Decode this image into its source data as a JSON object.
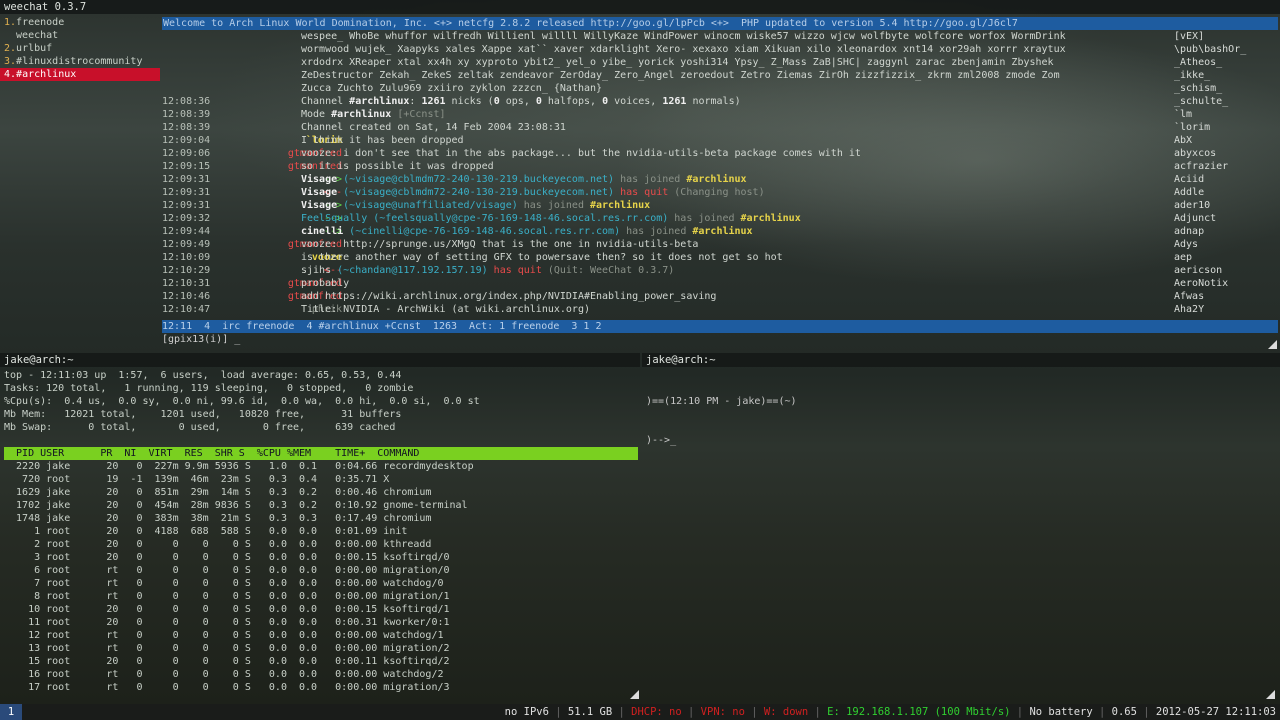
{
  "weechat": {
    "title": "weechat 0.3.7",
    "buffers": [
      {
        "num": "1.",
        "name": "freenode",
        "cur": false
      },
      {
        "num": "",
        "name": "weechat",
        "cur": false
      },
      {
        "num": "2.",
        "name": "urlbuf",
        "cur": false
      },
      {
        "num": "3.",
        "name": "#linuxdistrocommunity",
        "cur": false
      },
      {
        "num": "4.",
        "name": "#archlinux",
        "cur": true
      }
    ],
    "topic": "Welcome to Arch Linux World Domination, Inc. <+> netcfg 2.8.2 released http://goo.gl/lpPcb <+>  PHP updated to version 5.4 http://goo.gl/J6cl7",
    "names_lines": [
      "wespee_ WhoBe whuffor wilfredh Willienl willll WillyKaze WindPower winocm wiske57 wizzo wjcw wolfbyte wolfcore worfox WormDrink",
      "wormwood wujek_ Xaapyks xales Xappe xat`` xaver xdarklight Xero- xexaxo xiam Xikuan xilo xleonardox xnt14 xor29ah xorrr xraytux",
      "xrdodrx XReaper xtal xx4h xy xyproto ybit2_ yel_o yibe_ yorick yoshi314 Ypsy_ Z_Mass ZaB|SHC| zaggynl zarac zbenjamin Zbyshek",
      "ZeDestructor Zekah_ ZekeS zeltak zendeavor ZerOday_ Zero_Angel zeroedout Zetro Ziemas ZirOh zizzfizzix_ zkrm zml2008 zmode Zom",
      "Zucca Zuchto Zulu969 zxiiro zyklon zzzcn_ {Nathan}"
    ],
    "lines": [
      {
        "ts": "12:08:36",
        "nick": "--",
        "nc": "g",
        "parts": [
          [
            "m",
            "Channel "
          ],
          [
            "w",
            "#archlinux"
          ],
          [
            "m",
            ": "
          ],
          [
            "w",
            "1261"
          ],
          [
            "m",
            " nicks ("
          ],
          [
            "w",
            "0"
          ],
          [
            "m",
            " ops, "
          ],
          [
            "w",
            "0"
          ],
          [
            "m",
            " halfops, "
          ],
          [
            "w",
            "0"
          ],
          [
            "m",
            " voices, "
          ],
          [
            "w",
            "1261"
          ],
          [
            "m",
            " normals)"
          ]
        ]
      },
      {
        "ts": "12:08:39",
        "nick": "--",
        "nc": "g",
        "parts": [
          [
            "m",
            "Mode "
          ],
          [
            "w",
            "#archlinux"
          ],
          [
            "g",
            " [+Ccnst]"
          ]
        ]
      },
      {
        "ts": "12:08:39",
        "nick": "--",
        "nc": "g",
        "parts": [
          [
            "m",
            "Channel created on Sat, 14 Feb 2004 23:08:31"
          ]
        ]
      },
      {
        "ts": "12:09:04",
        "nick": "`lorim",
        "nc": "y",
        "parts": [
          [
            "m",
            "I think it has been dropped"
          ]
        ]
      },
      {
        "ts": "12:09:06",
        "nick": "gtmanfred",
        "nc": "p",
        "parts": [
          [
            "m",
            "vooze: i don't see that in the abs package... but the nvidia-utils-beta package comes with it"
          ]
        ]
      },
      {
        "ts": "12:09:15",
        "nick": "gtmanfred",
        "nc": "p",
        "parts": [
          [
            "m",
            "so it is possible it was dropped"
          ]
        ]
      },
      {
        "ts": "12:09:31",
        "nick": "-->",
        "nc": "j",
        "parts": [
          [
            "w",
            "Visage"
          ],
          [
            "c",
            " (~visage@cblmdm72-240-130-219.buckeyecom.net)"
          ],
          [
            "g",
            " has joined "
          ],
          [
            "y",
            "#archlinux"
          ]
        ]
      },
      {
        "ts": "12:09:31",
        "nick": "<--",
        "nc": "p",
        "parts": [
          [
            "w",
            "Visage"
          ],
          [
            "c",
            " (~visage@cblmdm72-240-130-219.buckeyecom.net)"
          ],
          [
            "p",
            " has quit"
          ],
          [
            "g",
            " (Changing host)"
          ]
        ]
      },
      {
        "ts": "12:09:31",
        "nick": "-->",
        "nc": "j",
        "parts": [
          [
            "w",
            "Visage"
          ],
          [
            "c",
            " (~visage@unaffiliated/visage)"
          ],
          [
            "g",
            " has joined "
          ],
          [
            "y",
            "#archlinux"
          ]
        ]
      },
      {
        "ts": "12:09:32",
        "nick": "-->",
        "nc": "j",
        "parts": [
          [
            "c",
            "FeelSqually (~feelsqually@cpe-76-169-148-46.socal.res.rr.com)"
          ],
          [
            "g",
            " has joined "
          ],
          [
            "y",
            "#archlinux"
          ]
        ]
      },
      {
        "ts": "12:09:44",
        "nick": "-->",
        "nc": "j",
        "parts": [
          [
            "w",
            "cinelli"
          ],
          [
            "c",
            " (~cinelli@cpe-76-169-148-46.socal.res.rr.com)"
          ],
          [
            "g",
            " has joined "
          ],
          [
            "y",
            "#archlinux"
          ]
        ]
      },
      {
        "ts": "12:09:49",
        "nick": "gtmanfred",
        "nc": "p",
        "parts": [
          [
            "m",
            "vooze: http://sprunge.us/XMgQ that is the one in nvidia-utils-beta"
          ]
        ]
      },
      {
        "ts": "12:10:09",
        "nick": "vooze",
        "nc": "y",
        "parts": [
          [
            "m",
            "is there another way of setting GFX to powersave then? so it does not get so hot"
          ]
        ]
      },
      {
        "ts": "12:10:29",
        "nick": "<--",
        "nc": "p",
        "parts": [
          [
            "m",
            "sjihs"
          ],
          [
            "c",
            " (~chandan@117.192.157.19)"
          ],
          [
            "p",
            " has quit"
          ],
          [
            "g",
            " (Quit: WeeChat 0.3.7)"
          ]
        ]
      },
      {
        "ts": "12:10:31",
        "nick": "gtmanfred",
        "nc": "p",
        "parts": [
          [
            "m",
            "probably"
          ]
        ]
      },
      {
        "ts": "12:10:46",
        "nick": "gtmanfred",
        "nc": "p",
        "parts": [
          [
            "m",
            "add https://wiki.archlinux.org/index.php/NVIDIA#Enabling_power_saving"
          ]
        ]
      },
      {
        "ts": "12:10:47",
        "nick": "phrik",
        "nc": "g",
        "parts": [
          [
            "m",
            "Title: NVIDIA - ArchWiki (at wiki.archlinux.org)"
          ]
        ]
      }
    ],
    "nicklist": [
      "[vEX]",
      "\\pub\\bashOr_",
      "_Atheos_",
      "_ikke_",
      "_schism_",
      "_schulte_",
      "`lm",
      "`lorim",
      "AbX",
      "abyxcos",
      "acfrazier",
      "Aciid",
      "Addle",
      "ader10",
      "Adjunct",
      "adnap",
      "Adys",
      "aep",
      "aericson",
      "AeroNotix",
      "Afwas",
      "Aha2Y"
    ],
    "status": [
      [
        "",
        "[12:11] "
      ],
      [
        "",
        "[4] "
      ],
      [
        "",
        "[irc/freenode] "
      ],
      [
        "w",
        "4:#archlinux"
      ],
      [
        "",
        "(+Ccnst)"
      ],
      [
        "",
        "{1263} "
      ],
      [
        "",
        "[Act: 1:freenode] "
      ],
      [
        "w",
        "3 1 2"
      ]
    ],
    "status_text": "12:11  4  irc freenode  4 #archlinux +Ccnst  1263  Act: 1 freenode  3 1 2",
    "input": "[gpix13(i)] _"
  },
  "term_left": {
    "title": "jake@arch:~",
    "summary": [
      "top - 12:11:03 up  1:57,  6 users,  load average: 0.65, 0.53, 0.44",
      "Tasks: 120 total,   1 running, 119 sleeping,   0 stopped,   0 zombie",
      "%Cpu(s):  0.4 us,  0.0 sy,  0.0 ni, 99.6 id,  0.0 wa,  0.0 hi,  0.0 si,  0.0 st",
      "Mb Mem:   12021 total,    1201 used,   10820 free,      31 buffers",
      "Mb Swap:      0 total,       0 used,       0 free,     639 cached"
    ],
    "header": "  PID USER      PR  NI  VIRT  RES  SHR S  %CPU %MEM    TIME+  COMMAND",
    "procs": [
      "  2220 jake      20   0  227m 9.9m 5936 S   1.0  0.1   0:04.66 recordmydesktop",
      "   720 root      19  -1  139m  46m  23m S   0.3  0.4   0:35.71 X",
      "  1629 jake      20   0  851m  29m  14m S   0.3  0.2   0:00.46 chromium",
      "  1702 jake      20   0  454m  28m 9836 S   0.3  0.2   0:10.92 gnome-terminal",
      "  1748 jake      20   0  383m  38m  21m S   0.3  0.3   0:17.49 chromium",
      "     1 root      20   0  4188  688  588 S   0.0  0.0   0:01.09 init",
      "     2 root      20   0     0    0    0 S   0.0  0.0   0:00.00 kthreadd",
      "     3 root      20   0     0    0    0 S   0.0  0.0   0:00.15 ksoftirqd/0",
      "     6 root      rt   0     0    0    0 S   0.0  0.0   0:00.00 migration/0",
      "     7 root      rt   0     0    0    0 S   0.0  0.0   0:00.00 watchdog/0",
      "     8 root      rt   0     0    0    0 S   0.0  0.0   0:00.00 migration/1",
      "    10 root      20   0     0    0    0 S   0.0  0.0   0:00.15 ksoftirqd/1",
      "    11 root      20   0     0    0    0 S   0.0  0.0   0:00.31 kworker/0:1",
      "    12 root      rt   0     0    0    0 S   0.0  0.0   0:00.00 watchdog/1",
      "    13 root      rt   0     0    0    0 S   0.0  0.0   0:00.00 migration/2",
      "    15 root      20   0     0    0    0 S   0.0  0.0   0:00.11 ksoftirqd/2",
      "    16 root      rt   0     0    0    0 S   0.0  0.0   0:00.00 watchdog/2",
      "    17 root      rt   0     0    0    0 S   0.0  0.0   0:00.00 migration/3"
    ]
  },
  "term_right": {
    "title": "jake@arch:~",
    "prompt1": ")==(12:10 PM - jake)==(~)",
    "prompt2": ")-->_"
  },
  "bar": {
    "workspace": "1",
    "ipv6": "no IPv6",
    "disk": "51.1 GB",
    "dhcp": "DHCP: no",
    "vpn": "VPN: no",
    "wdown": "W: down",
    "eth": "E: 192.168.1.107 (100 Mbit/s)",
    "battery": "No battery",
    "load": "0.65",
    "datetime": "2012-05-27 12:11:03"
  },
  "colors": {
    "topic_bg": "#1e5ca0",
    "highlight": "#c8102a",
    "top_header": "#7ad020"
  }
}
